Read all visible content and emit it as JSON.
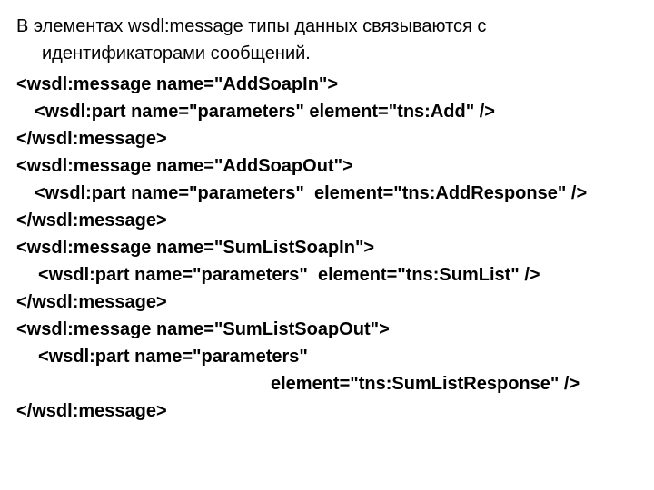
{
  "intro": "В элементах wsdl:message типы данных связываются с идентификаторами сообщений.",
  "code": {
    "l1": "<wsdl:message name=\"AddSoapIn\">",
    "l2": "<wsdl:part name=\"parameters\" element=\"tns:Add\" />",
    "l3": "</wsdl:message>",
    "l4": "<wsdl:message name=\"AddSoapOut\">",
    "l5": "<wsdl:part name=\"parameters\"  element=\"tns:AddResponse\" />",
    "l6": "</wsdl:message>",
    "l7": "<wsdl:message name=\"SumListSoapIn\">",
    "l8": "<wsdl:part name=\"parameters\"  element=\"tns:SumList\" />",
    "l9": "</wsdl:message>",
    "l10": "<wsdl:message name=\"SumListSoapOut\">",
    "l11": "<wsdl:part name=\"parameters\"",
    "l12": "element=\"tns:SumListResponse\" />",
    "l13": "</wsdl:message>"
  }
}
